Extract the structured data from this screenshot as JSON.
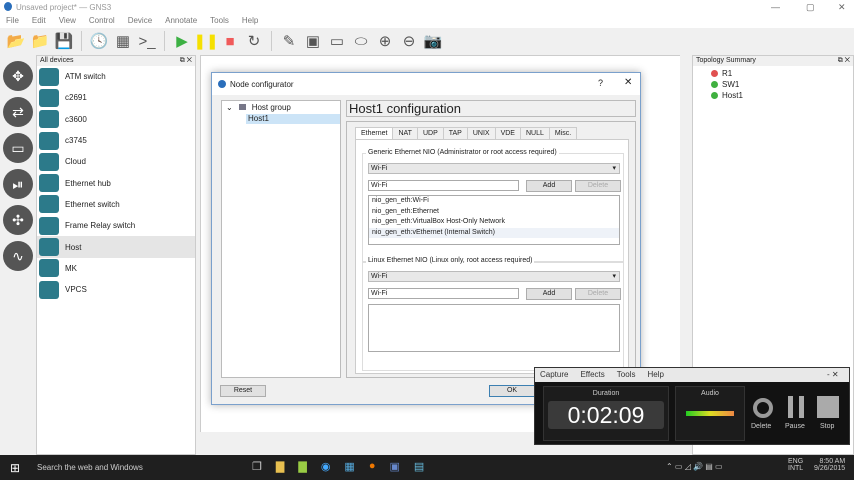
{
  "window": {
    "title": "Unsaved project* — GNS3"
  },
  "menu": [
    "File",
    "Edit",
    "View",
    "Control",
    "Device",
    "Annotate",
    "Tools",
    "Help"
  ],
  "toolbar": [
    {
      "name": "new-project-icon",
      "glyph": "📂"
    },
    {
      "name": "open-project-icon",
      "glyph": "📁"
    },
    {
      "name": "save-project-icon",
      "glyph": "💾"
    },
    {
      "name": "snapshot-icon",
      "glyph": "🕓"
    },
    {
      "name": "show-interfaces-icon",
      "glyph": "▦"
    },
    {
      "name": "console-icon",
      "glyph": ">_"
    },
    {
      "name": "start-icon",
      "glyph": "▶",
      "color": "#3cb043"
    },
    {
      "name": "suspend-icon",
      "glyph": "❚❚",
      "color": "#f5e000"
    },
    {
      "name": "stop-icon",
      "glyph": "■",
      "color": "#f05a5a"
    },
    {
      "name": "reload-icon",
      "glyph": "↻"
    },
    {
      "name": "add-note-icon",
      "glyph": "✎"
    },
    {
      "name": "insert-image-icon",
      "glyph": "▣"
    },
    {
      "name": "draw-rectangle-icon",
      "glyph": "▭"
    },
    {
      "name": "draw-ellipse-icon",
      "glyph": "⬭"
    },
    {
      "name": "zoom-in-icon",
      "glyph": "⊕"
    },
    {
      "name": "zoom-out-icon",
      "glyph": "⊖"
    },
    {
      "name": "screenshot-icon",
      "glyph": "📷"
    }
  ],
  "left_icons": [
    {
      "name": "routers-icon",
      "glyph": "✥"
    },
    {
      "name": "switches-icon",
      "glyph": "⇄"
    },
    {
      "name": "end-devices-icon",
      "glyph": "▭"
    },
    {
      "name": "security-devices-icon",
      "glyph": "⏯"
    },
    {
      "name": "all-devices-icon",
      "glyph": "✣"
    },
    {
      "name": "add-link-icon",
      "glyph": "∿"
    }
  ],
  "devices": {
    "title": "All devices",
    "items": [
      "ATM switch",
      "c2691",
      "c3600",
      "c3745",
      "Cloud",
      "Ethernet hub",
      "Ethernet switch",
      "Frame Relay switch",
      "Host",
      "MK",
      "VPCS"
    ],
    "selected": "Host"
  },
  "topology": {
    "title": "Topology Summary",
    "nodes": [
      {
        "name": "R1",
        "color": "#e05050"
      },
      {
        "name": "SW1",
        "color": "#40b040"
      },
      {
        "name": "Host1",
        "color": "#40b040"
      }
    ]
  },
  "dialog": {
    "title": "Node configurator",
    "help": "?",
    "close": "✕",
    "tree": {
      "group": "Host group",
      "item": "Host1"
    },
    "config_title": "Host1 configuration",
    "tabs": [
      "Ethernet",
      "NAT",
      "UDP",
      "TAP",
      "UNIX",
      "VDE",
      "NULL",
      "Misc."
    ],
    "generic": {
      "label": "Generic Ethernet NIO (Administrator or root access required)",
      "combo": "Wi-Fi",
      "input": "Wi-Fi",
      "add": "Add",
      "delete": "Delete",
      "list": [
        "nio_gen_eth:Wi-Fi",
        "nio_gen_eth:Ethernet",
        "nio_gen_eth:VirtualBox Host-Only Network",
        "nio_gen_eth:vEthernet (Internal Switch)"
      ]
    },
    "linux": {
      "label": "Linux Ethernet NIO (Linux only, root access required)",
      "combo": "Wi-Fi",
      "input": "Wi-Fi",
      "add": "Add",
      "delete": "Delete"
    },
    "reset": "Reset",
    "ok": "OK"
  },
  "recorder": {
    "menu": [
      "Capture",
      "Effects",
      "Tools",
      "Help"
    ],
    "duration_label": "Duration",
    "duration": "0:02:09",
    "audio_label": "Audio",
    "delete": "Delete",
    "pause": "Pause",
    "stop": "Stop"
  },
  "taskbar": {
    "search": "Search the web and Windows",
    "lang1": "ENG",
    "lang2": "INTL",
    "time": "8:50 AM",
    "date": "9/26/2015"
  }
}
